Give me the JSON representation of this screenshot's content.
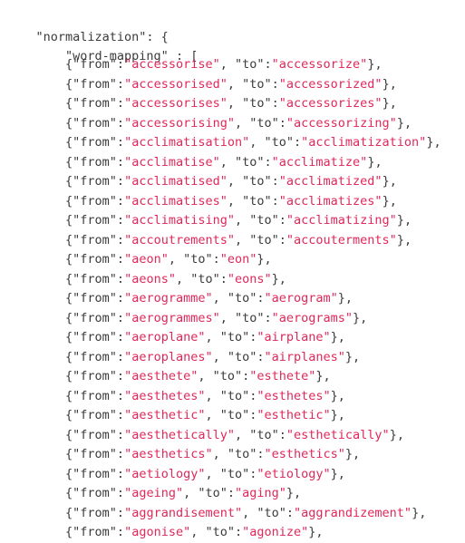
{
  "editor": {
    "language": "json",
    "background_color": "#ffffff",
    "punctuation_color": "#3b3b3b",
    "key_color": "#3b3b3b",
    "string_value_color": "#e0285a",
    "font_size_px": 13.5,
    "line_height_px": 21.5
  },
  "code": {
    "root_key_line": "\"normalization\": {",
    "array_key_line": "    \"word-mapping\" : [",
    "indent_entry": "        ",
    "entry_prefix": "{\"from\":",
    "entry_separator": ", \"to\":",
    "entry_suffix": "},",
    "entries": [
      {
        "from": "\"accessorise\"",
        "to": "\"accessorize\""
      },
      {
        "from": "\"accessorised\"",
        "to": "\"accessorized\""
      },
      {
        "from": "\"accessorises\"",
        "to": "\"accessorizes\""
      },
      {
        "from": "\"accessorising\"",
        "to": "\"accessorizing\""
      },
      {
        "from": "\"acclimatisation\"",
        "to": "\"acclimatization\""
      },
      {
        "from": "\"acclimatise\"",
        "to": "\"acclimatize\""
      },
      {
        "from": "\"acclimatised\"",
        "to": "\"acclimatized\""
      },
      {
        "from": "\"acclimatises\"",
        "to": "\"acclimatizes\""
      },
      {
        "from": "\"acclimatising\"",
        "to": "\"acclimatizing\""
      },
      {
        "from": "\"accoutrements\"",
        "to": "\"accouterments\""
      },
      {
        "from": "\"aeon\"",
        "to": "\"eon\""
      },
      {
        "from": "\"aeons\"",
        "to": "\"eons\""
      },
      {
        "from": "\"aerogramme\"",
        "to": "\"aerogram\""
      },
      {
        "from": "\"aerogrammes\"",
        "to": "\"aerograms\""
      },
      {
        "from": "\"aeroplane\"",
        "to": "\"airplane\""
      },
      {
        "from": "\"aeroplanes\"",
        "to": "\"airplanes\""
      },
      {
        "from": "\"aesthete\"",
        "to": "\"esthete\""
      },
      {
        "from": "\"aesthetes\"",
        "to": "\"esthetes\""
      },
      {
        "from": "\"aesthetic\"",
        "to": "\"esthetic\""
      },
      {
        "from": "\"aesthetically\"",
        "to": "\"esthetically\""
      },
      {
        "from": "\"aesthetics\"",
        "to": "\"esthetics\""
      },
      {
        "from": "\"aetiology\"",
        "to": "\"etiology\""
      },
      {
        "from": "\"ageing\"",
        "to": "\"aging\""
      },
      {
        "from": "\"aggrandisement\"",
        "to": "\"aggrandizement\""
      },
      {
        "from": "\"agonise\"",
        "to": "\"agonize\""
      }
    ]
  }
}
